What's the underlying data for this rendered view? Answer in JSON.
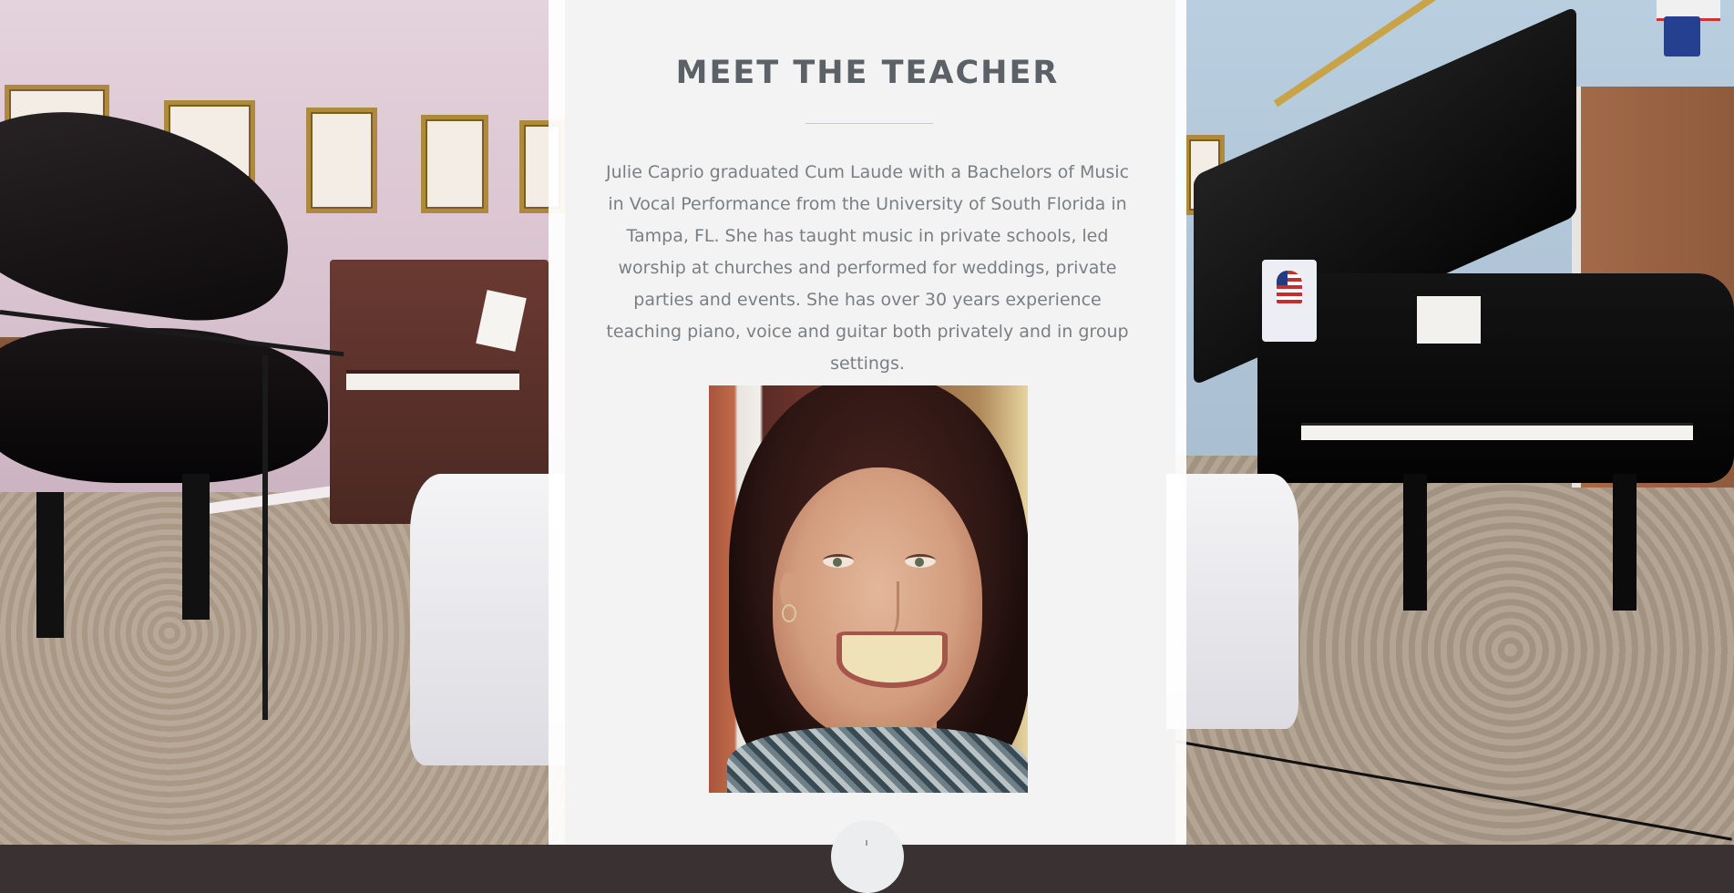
{
  "section": {
    "title": "MEET THE TEACHER",
    "bio": "Julie Caprio graduated Cum Laude with a Bachelors of Music in Vocal Performance from the University of South Florida in Tampa, FL. She has taught music in private schools, led worship at churches and performed for weddings, private parties and events. She has over 30 years experience teaching piano, voice and guitar both privately and in group settings."
  },
  "colors": {
    "title": "#5b6166",
    "body_text": "#7a7f84",
    "panel": "#ffffff",
    "divider": "#c8ccd0"
  },
  "icons": {
    "scroll_button": "scroll-down-icon"
  }
}
